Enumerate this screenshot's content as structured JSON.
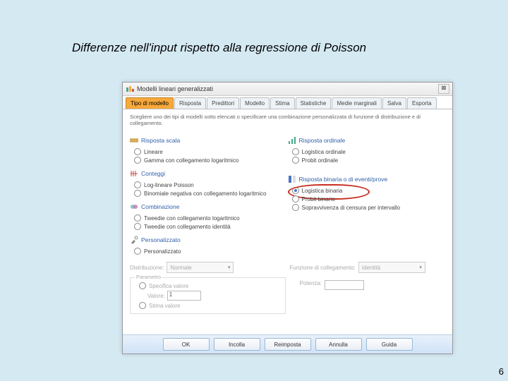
{
  "slide": {
    "title": "Differenze nell'input rispetto alla regressione di Poisson",
    "page_number": "6"
  },
  "dialog": {
    "title": "Modelli lineari generalizzati",
    "close_glyph": "⊠"
  },
  "tabs": [
    {
      "label": "Tipo di modello",
      "active": true
    },
    {
      "label": "Risposta",
      "active": false
    },
    {
      "label": "Predittori",
      "active": false
    },
    {
      "label": "Modello",
      "active": false
    },
    {
      "label": "Stima",
      "active": false
    },
    {
      "label": "Statistiche",
      "active": false
    },
    {
      "label": "Medie marginali",
      "active": false
    },
    {
      "label": "Salva",
      "active": false
    },
    {
      "label": "Esporta",
      "active": false
    }
  ],
  "instr": "Scegliere uno dei tipi di modelli sotto elencati o specificare una combinazione personalizzata di funzione di distribuzione e di collegamento.",
  "left": {
    "scalar": {
      "title": "Risposta scala",
      "options": [
        {
          "label": "Lineare",
          "selected": false
        },
        {
          "label": "Gamma con collegamento logaritmico",
          "selected": false
        }
      ]
    },
    "counts": {
      "title": "Conteggi",
      "options": [
        {
          "label": "Log-lineare Poisson",
          "selected": false
        },
        {
          "label": "Binomiale negativa con collegamento logaritmico",
          "selected": false
        }
      ]
    },
    "mix": {
      "title": "Combinazione",
      "options": [
        {
          "label": "Tweedie con collegamento logaritmico",
          "selected": false
        },
        {
          "label": "Tweedie con collegamento identità",
          "selected": false
        }
      ]
    },
    "custom": {
      "title": "Personalizzato",
      "option": {
        "label": "Personalizzato",
        "selected": false
      }
    }
  },
  "right": {
    "ordinal": {
      "title": "Risposta ordinale",
      "options": [
        {
          "label": "Logistica ordinale",
          "selected": false
        },
        {
          "label": "Probit ordinale",
          "selected": false
        }
      ]
    },
    "binary": {
      "title": "Risposta binaria o di eventi/prove",
      "options": [
        {
          "label": "Logistica binaria",
          "selected": true,
          "circle": true
        },
        {
          "label": "Probit binario",
          "selected": false
        },
        {
          "label": "Sopravvivenza di censura per intervallo",
          "selected": false
        }
      ]
    }
  },
  "lower": {
    "dist_label": "Distribuzione:",
    "dist_value": "Normale",
    "link_label": "Funzione di collegamento:",
    "link_value": "Identità",
    "param_legend": "Parametro",
    "spec_label": "Specifica valore",
    "value_label": "Valore:",
    "value_value": "1",
    "estimate_label": "Stima valore",
    "power_label": "Potenza:"
  },
  "buttons": {
    "ok": "OK",
    "paste": "Incolla",
    "reset": "Reimposta",
    "cancel": "Annulla",
    "help": "Guida"
  }
}
